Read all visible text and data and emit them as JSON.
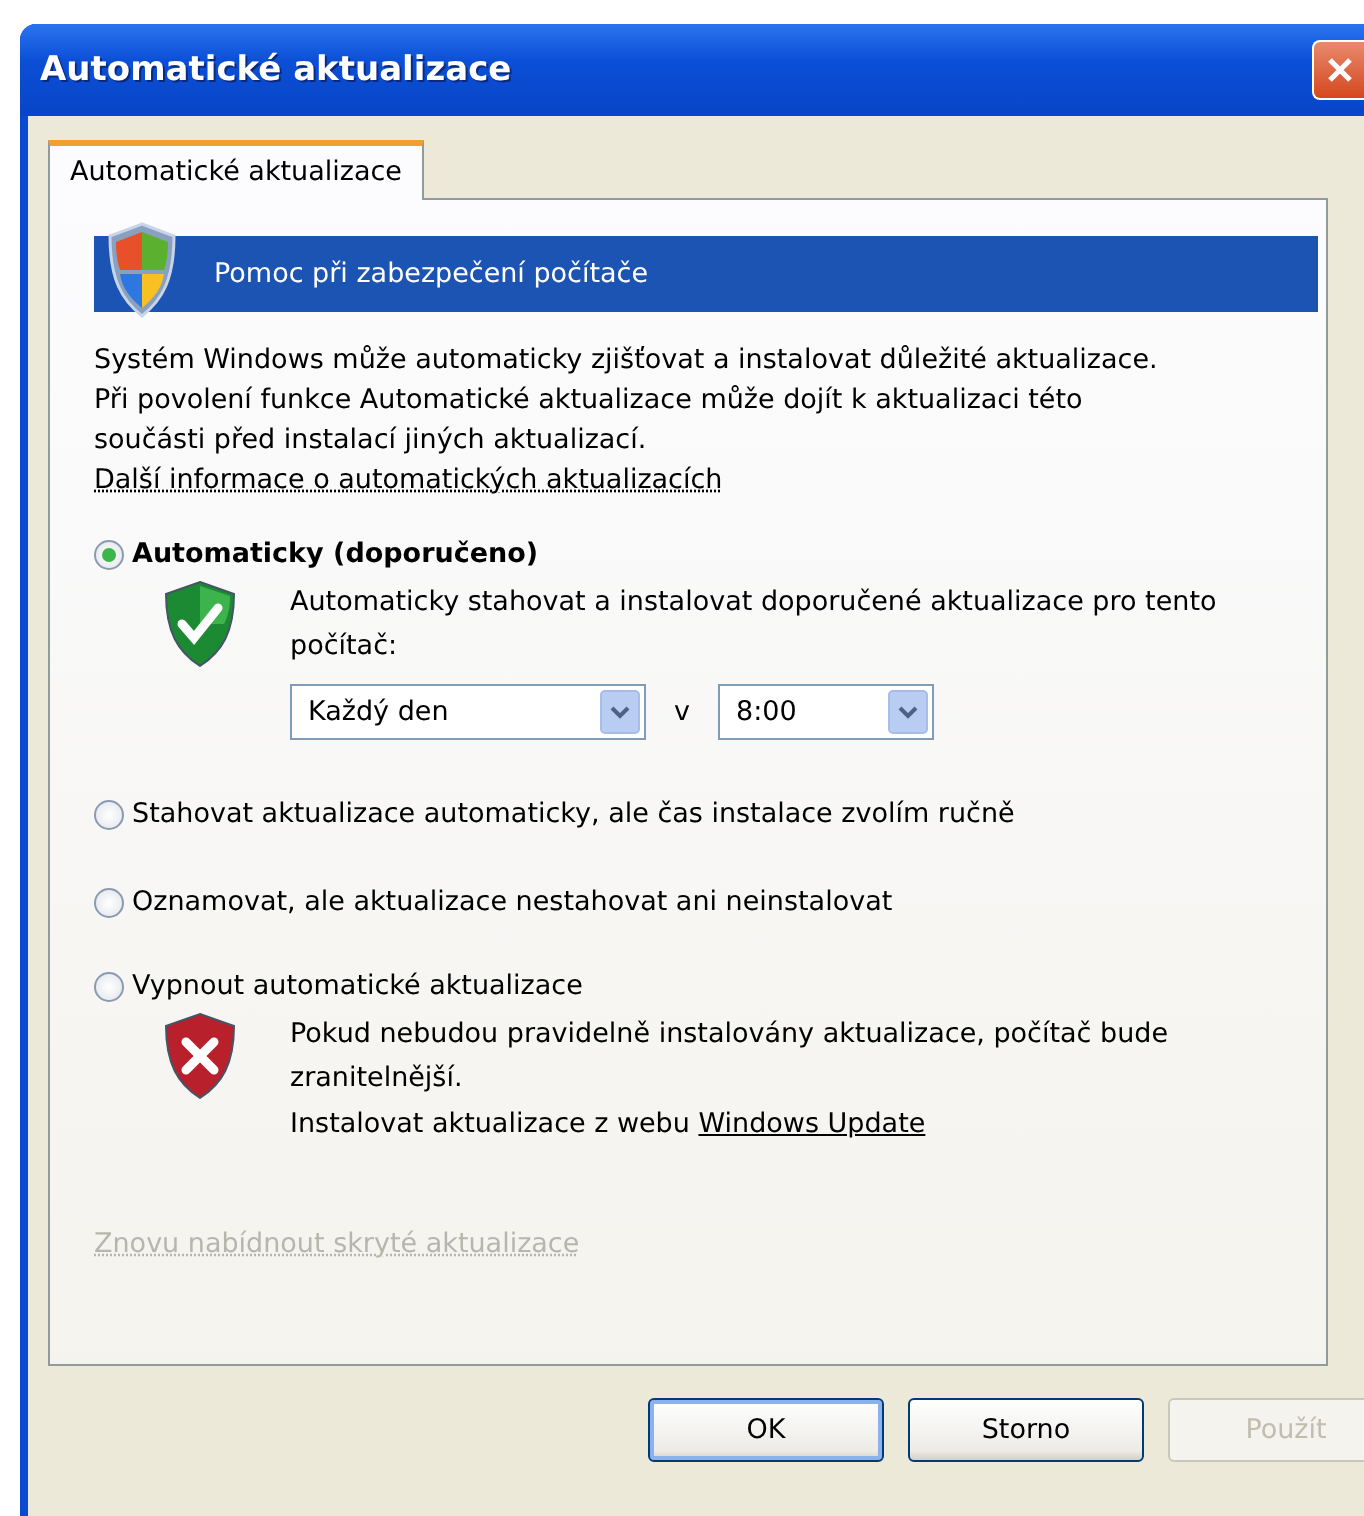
{
  "window": {
    "title": "Automatické aktualizace"
  },
  "tabs": [
    {
      "label": "Automatické aktualizace",
      "selected": true
    }
  ],
  "banner": {
    "text": "Pomoc při zabezpečení počítače"
  },
  "intro": "Systém Windows může automaticky zjišťovat a instalovat důležité aktualizace. Při povolení funkce Automatické aktualizace může dojít k aktualizaci této součásti před instalací jiných aktualizací.",
  "info_link": "Další informace o automatických aktualizacích",
  "options": [
    {
      "label": "Automaticky (doporučeno)",
      "kind": "recommended",
      "selected": true,
      "detail": {
        "kind": "recommendation",
        "text": "Automaticky stahovat a instalovat doporučené aktualizace pro tento počítač:"
      },
      "schedule": {
        "day": "Každý den",
        "at": "v",
        "time": "8:00"
      }
    },
    {
      "label": "Stahovat aktualizace automaticky, ale čas instalace zvolím ručně",
      "kind": "plain",
      "selected": false
    },
    {
      "label": "Oznamovat, ale aktualizace nestahovat ani neinstalovat",
      "kind": "plain",
      "selected": false
    },
    {
      "label": "Vypnout automatické aktualizace",
      "kind": "plain",
      "selected": false,
      "detail": {
        "kind": "warning",
        "text": "Pokud nebudou pravidelně instalovány aktualizace, počítač bude zranitelnější."
      },
      "update_line": {
        "text": "Instalovat aktualizace z webu",
        "link": "Windows Update"
      }
    }
  ],
  "hidden_updates_link": {
    "text": "Znovu nabídnout skryté aktualizace",
    "disabled": true
  },
  "buttons": [
    {
      "label": "OK",
      "default": true,
      "disabled": false
    },
    {
      "label": "Storno",
      "default": false,
      "disabled": false
    },
    {
      "label": "Použít",
      "default": false,
      "disabled": true
    }
  ]
}
